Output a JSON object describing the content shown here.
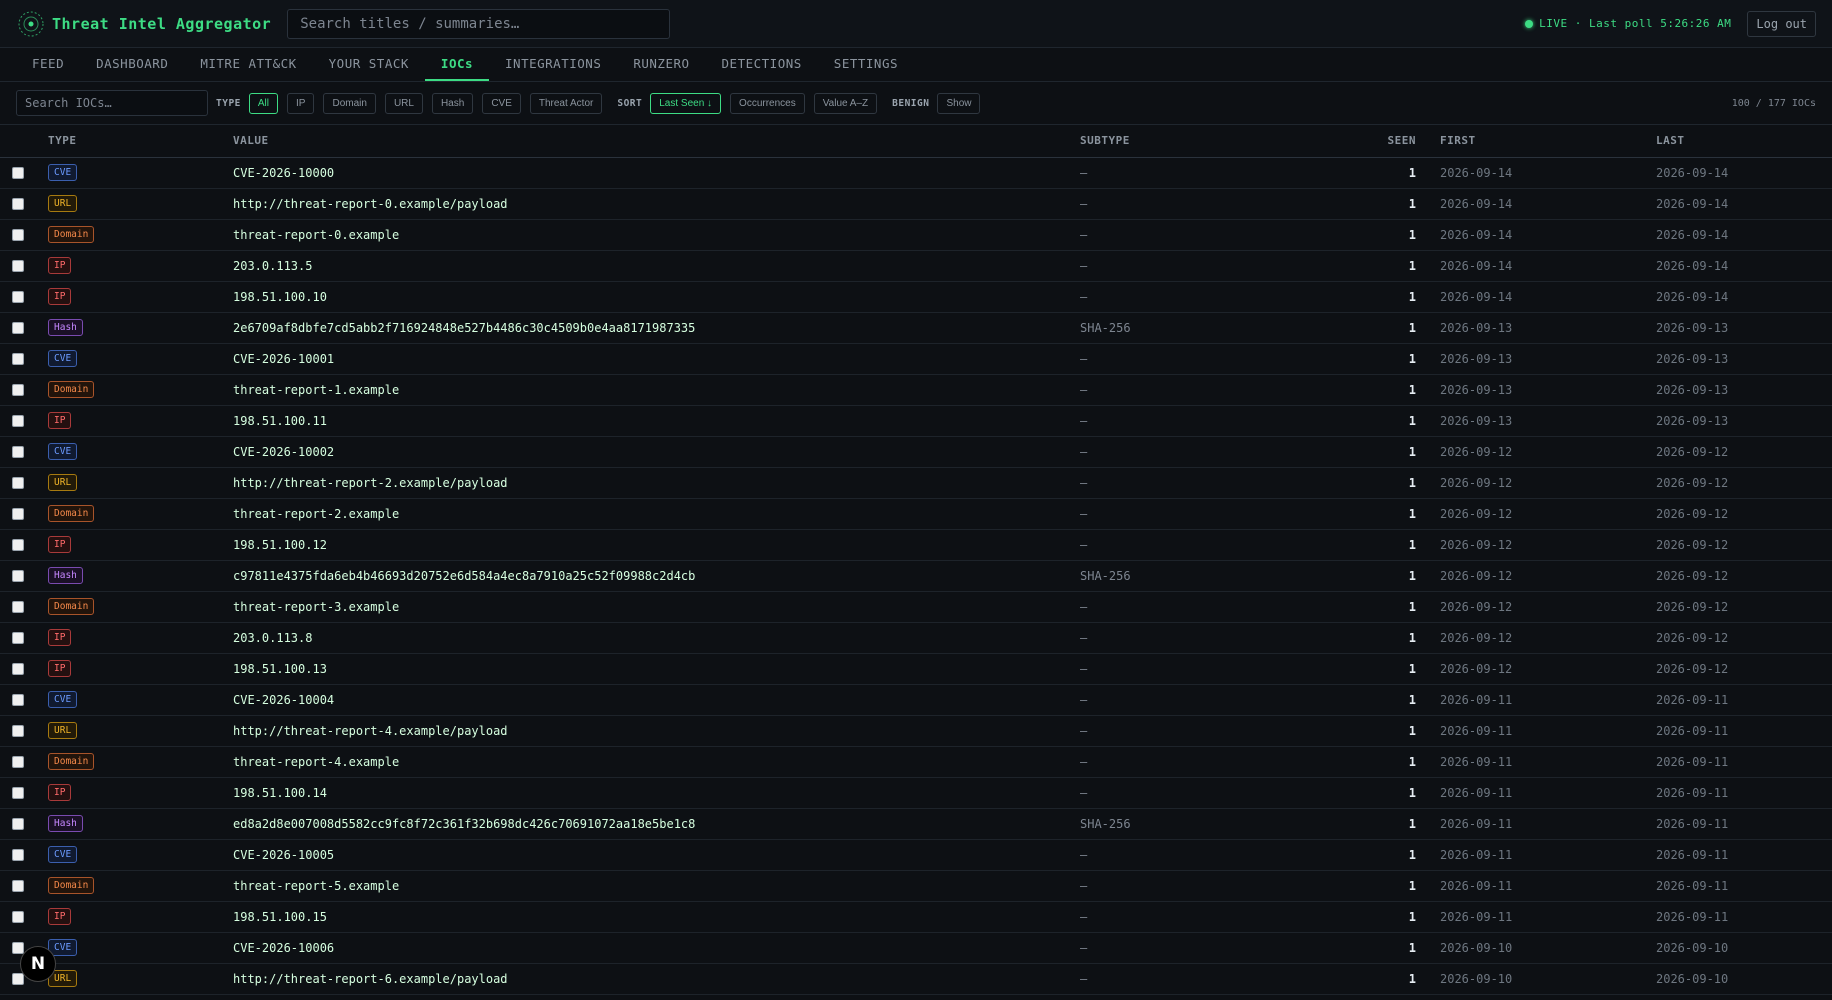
{
  "app": {
    "title": "Threat Intel Aggregator",
    "search_placeholder": "Search titles / summaries…",
    "live_status": "LIVE · Last poll 5:26:26 AM",
    "logout_label": "Log out"
  },
  "nav": {
    "tabs": [
      "FEED",
      "DASHBOARD",
      "MITRE ATT&CK",
      "YOUR STACK",
      "IOCs",
      "INTEGRATIONS",
      "RUNZERO",
      "DETECTIONS",
      "SETTINGS"
    ],
    "active": "IOCs"
  },
  "filters": {
    "search_placeholder": "Search IOCs…",
    "type_label": "TYPE",
    "type_options": [
      "All",
      "IP",
      "Domain",
      "URL",
      "Hash",
      "CVE",
      "Threat Actor"
    ],
    "type_active": "All",
    "sort_label": "SORT",
    "sort_options": [
      "Last Seen ↓",
      "Occurrences",
      "Value A–Z"
    ],
    "sort_active": "Last Seen ↓",
    "benign_label": "BENIGN",
    "benign_option": "Show",
    "count_text": "100 / 177 IOCs"
  },
  "table": {
    "columns": [
      "TYPE",
      "VALUE",
      "SUBTYPE",
      "SEEN",
      "FIRST",
      "LAST"
    ],
    "rows": [
      {
        "type": "CVE",
        "value": "CVE-2026-10000",
        "subtype": "—",
        "seen": "1",
        "first": "2026-09-14",
        "last": "2026-09-14"
      },
      {
        "type": "URL",
        "value": "http://threat-report-0.example/payload",
        "subtype": "—",
        "seen": "1",
        "first": "2026-09-14",
        "last": "2026-09-14"
      },
      {
        "type": "Domain",
        "value": "threat-report-0.example",
        "subtype": "—",
        "seen": "1",
        "first": "2026-09-14",
        "last": "2026-09-14"
      },
      {
        "type": "IP",
        "value": "203.0.113.5",
        "subtype": "—",
        "seen": "1",
        "first": "2026-09-14",
        "last": "2026-09-14"
      },
      {
        "type": "IP",
        "value": "198.51.100.10",
        "subtype": "—",
        "seen": "1",
        "first": "2026-09-14",
        "last": "2026-09-14"
      },
      {
        "type": "Hash",
        "value": "2e6709af8dbfe7cd5abb2f716924848e527b4486c30c4509b0e4aa8171987335",
        "subtype": "SHA-256",
        "seen": "1",
        "first": "2026-09-13",
        "last": "2026-09-13"
      },
      {
        "type": "CVE",
        "value": "CVE-2026-10001",
        "subtype": "—",
        "seen": "1",
        "first": "2026-09-13",
        "last": "2026-09-13"
      },
      {
        "type": "Domain",
        "value": "threat-report-1.example",
        "subtype": "—",
        "seen": "1",
        "first": "2026-09-13",
        "last": "2026-09-13"
      },
      {
        "type": "IP",
        "value": "198.51.100.11",
        "subtype": "—",
        "seen": "1",
        "first": "2026-09-13",
        "last": "2026-09-13"
      },
      {
        "type": "CVE",
        "value": "CVE-2026-10002",
        "subtype": "—",
        "seen": "1",
        "first": "2026-09-12",
        "last": "2026-09-12"
      },
      {
        "type": "URL",
        "value": "http://threat-report-2.example/payload",
        "subtype": "—",
        "seen": "1",
        "first": "2026-09-12",
        "last": "2026-09-12"
      },
      {
        "type": "Domain",
        "value": "threat-report-2.example",
        "subtype": "—",
        "seen": "1",
        "first": "2026-09-12",
        "last": "2026-09-12"
      },
      {
        "type": "IP",
        "value": "198.51.100.12",
        "subtype": "—",
        "seen": "1",
        "first": "2026-09-12",
        "last": "2026-09-12"
      },
      {
        "type": "Hash",
        "value": "c97811e4375fda6eb4b46693d20752e6d584a4ec8a7910a25c52f09988c2d4cb",
        "subtype": "SHA-256",
        "seen": "1",
        "first": "2026-09-12",
        "last": "2026-09-12"
      },
      {
        "type": "Domain",
        "value": "threat-report-3.example",
        "subtype": "—",
        "seen": "1",
        "first": "2026-09-12",
        "last": "2026-09-12"
      },
      {
        "type": "IP",
        "value": "203.0.113.8",
        "subtype": "—",
        "seen": "1",
        "first": "2026-09-12",
        "last": "2026-09-12"
      },
      {
        "type": "IP",
        "value": "198.51.100.13",
        "subtype": "—",
        "seen": "1",
        "first": "2026-09-12",
        "last": "2026-09-12"
      },
      {
        "type": "CVE",
        "value": "CVE-2026-10004",
        "subtype": "—",
        "seen": "1",
        "first": "2026-09-11",
        "last": "2026-09-11"
      },
      {
        "type": "URL",
        "value": "http://threat-report-4.example/payload",
        "subtype": "—",
        "seen": "1",
        "first": "2026-09-11",
        "last": "2026-09-11"
      },
      {
        "type": "Domain",
        "value": "threat-report-4.example",
        "subtype": "—",
        "seen": "1",
        "first": "2026-09-11",
        "last": "2026-09-11"
      },
      {
        "type": "IP",
        "value": "198.51.100.14",
        "subtype": "—",
        "seen": "1",
        "first": "2026-09-11",
        "last": "2026-09-11"
      },
      {
        "type": "Hash",
        "value": "ed8a2d8e007008d5582cc9fc8f72c361f32b698dc426c70691072aa18e5be1c8",
        "subtype": "SHA-256",
        "seen": "1",
        "first": "2026-09-11",
        "last": "2026-09-11"
      },
      {
        "type": "CVE",
        "value": "CVE-2026-10005",
        "subtype": "—",
        "seen": "1",
        "first": "2026-09-11",
        "last": "2026-09-11"
      },
      {
        "type": "Domain",
        "value": "threat-report-5.example",
        "subtype": "—",
        "seen": "1",
        "first": "2026-09-11",
        "last": "2026-09-11"
      },
      {
        "type": "IP",
        "value": "198.51.100.15",
        "subtype": "—",
        "seen": "1",
        "first": "2026-09-11",
        "last": "2026-09-11"
      },
      {
        "type": "CVE",
        "value": "CVE-2026-10006",
        "subtype": "—",
        "seen": "1",
        "first": "2026-09-10",
        "last": "2026-09-10"
      },
      {
        "type": "URL",
        "value": "http://threat-report-6.example/payload",
        "subtype": "—",
        "seen": "1",
        "first": "2026-09-10",
        "last": "2026-09-10"
      }
    ]
  },
  "colors": {
    "accent": "#3ddc84",
    "background": "#0d1014"
  },
  "overlay": {
    "next_badge": "N"
  }
}
